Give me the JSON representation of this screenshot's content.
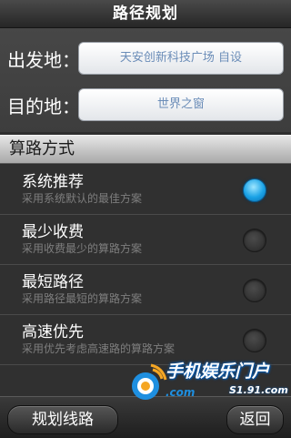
{
  "header": {
    "title": "路径规划"
  },
  "form": {
    "origin_label": "出发地：",
    "origin_value": "天安创新科技广场 自设",
    "destination_label": "目的地：",
    "destination_value": "世界之窗"
  },
  "route_section": {
    "heading": "算路方式",
    "options": [
      {
        "title": "系统推荐",
        "desc": "采用系统默认的最佳方案",
        "selected": true
      },
      {
        "title": "最少收费",
        "desc": "采用收费最少的算路方案",
        "selected": false
      },
      {
        "title": "最短路径",
        "desc": "采用路径最短的算路方案",
        "selected": false
      },
      {
        "title": "高速优先",
        "desc": "采用优先考虑高速路的算路方案",
        "selected": false
      }
    ]
  },
  "footer": {
    "plan_button": "规划线路",
    "back_button": "返回"
  },
  "watermark": {
    "name": "手机娱乐门户",
    "url": "S1.91.com",
    "com": ".com"
  },
  "colors": {
    "accent": "#1aa2e6",
    "field_text": "#6b8db8",
    "watermark_blue": "#0a5db3"
  }
}
